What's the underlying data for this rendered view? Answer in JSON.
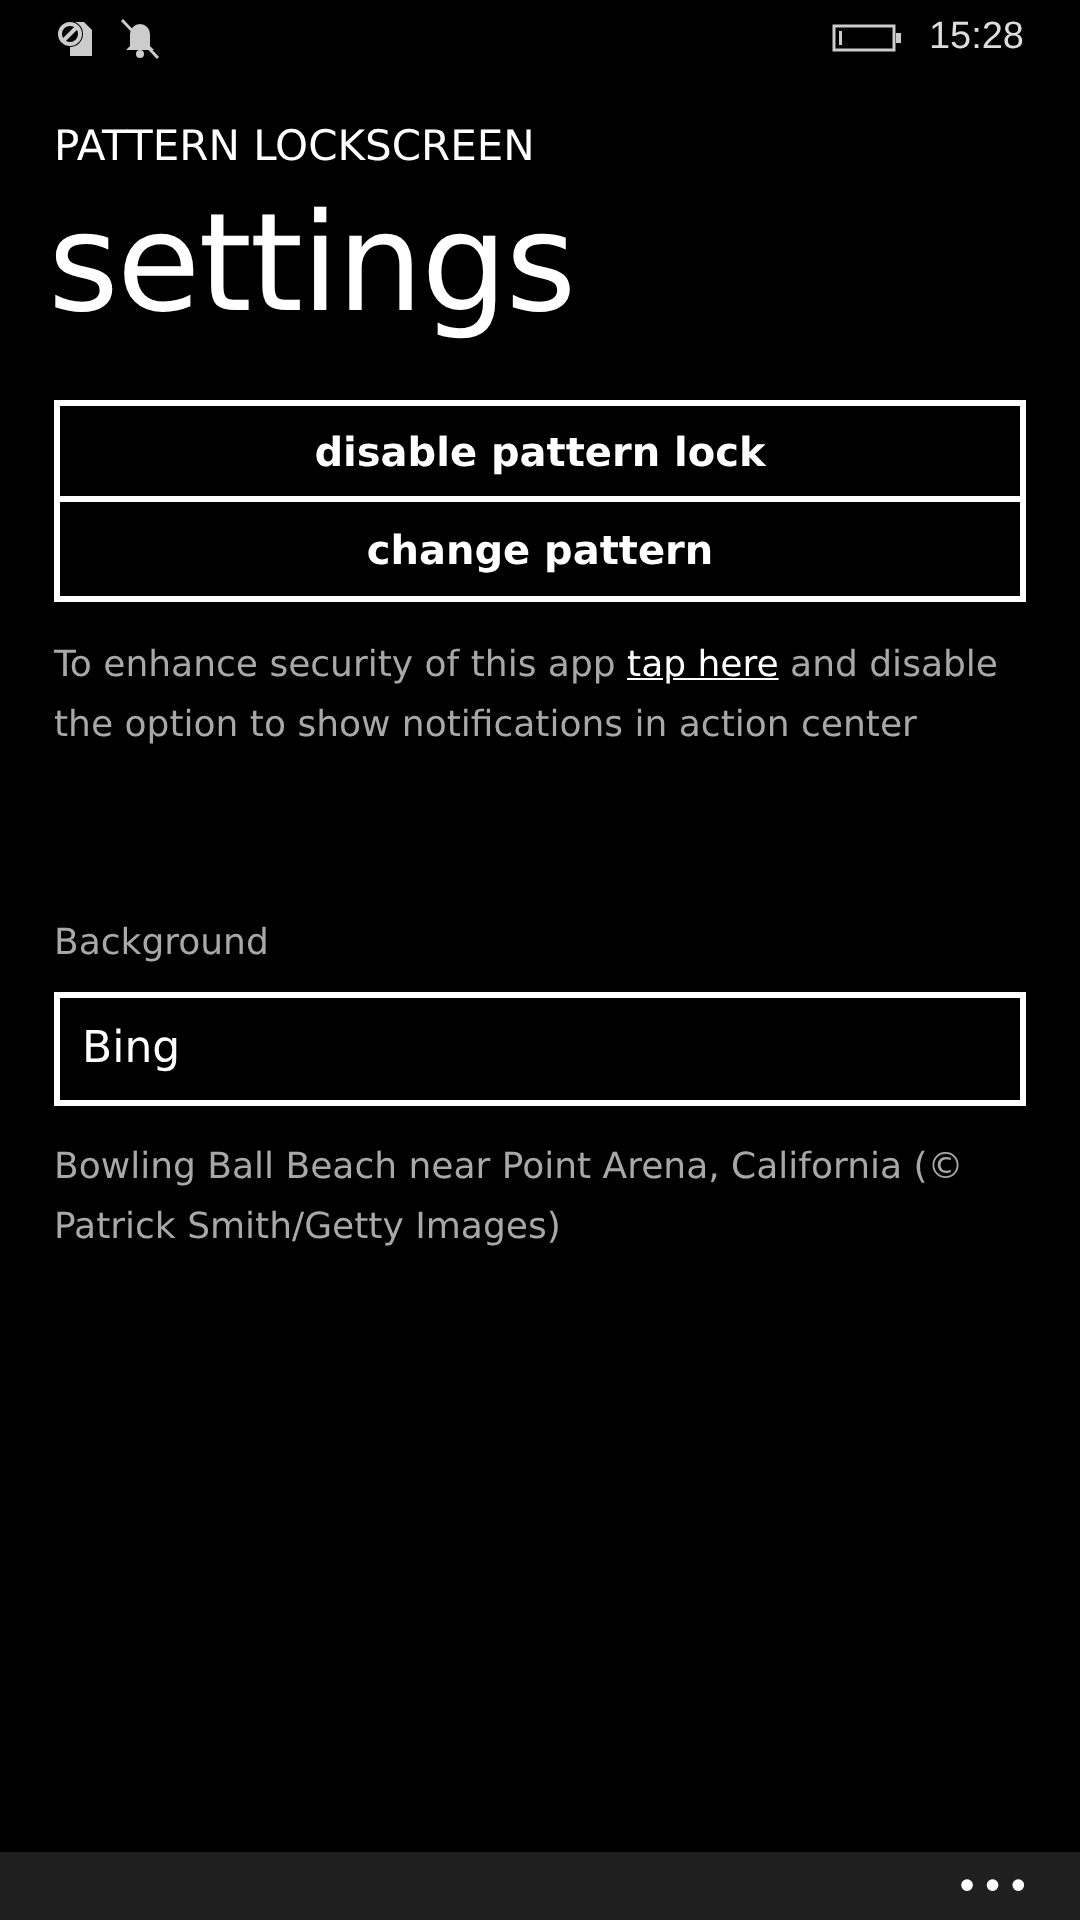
{
  "status_bar": {
    "time": "15:28"
  },
  "app_title": "PATTERN LOCKSCREEN",
  "page_title": "settings",
  "buttons": [
    "disable pattern lock",
    "change pattern"
  ],
  "notice": {
    "before": "To enhance security of this app ",
    "link": "tap here",
    "after": " and disable the option to show notifications in action center"
  },
  "background": {
    "label": "Background",
    "value": "Bing",
    "caption": "Bowling Ball Beach near Point Arena, California (© Patrick Smith/Getty Images)"
  },
  "app_bar": {
    "more": "•••"
  }
}
